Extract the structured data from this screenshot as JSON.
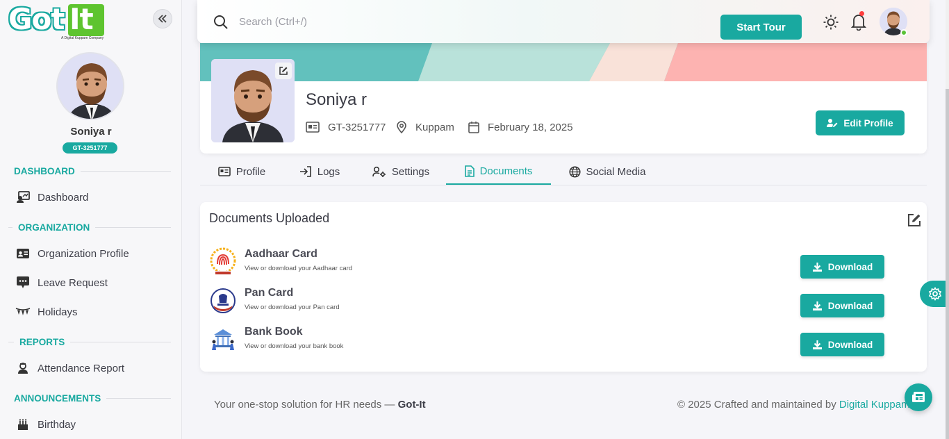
{
  "brand": {
    "logo_got": "Got",
    "logo_it": "It",
    "logo_tagline": "A Digital Kuppam Company"
  },
  "sidebar": {
    "collapse_icon": "double-chevron-left-icon",
    "user_name": "Soniya r",
    "user_id": "GT-3251777",
    "sections": [
      {
        "title": "DASHBOARD",
        "items": [
          {
            "label": "Dashboard",
            "icon": "dashboard-icon"
          }
        ]
      },
      {
        "title": "ORGANIZATION",
        "items": [
          {
            "label": "Organization Profile",
            "icon": "id-card-icon"
          },
          {
            "label": "Leave Request",
            "icon": "leave-request-icon"
          },
          {
            "label": "Holidays",
            "icon": "holidays-icon"
          }
        ]
      },
      {
        "title": "REPORTS",
        "items": [
          {
            "label": "Attendance Report",
            "icon": "attendance-report-icon"
          }
        ]
      },
      {
        "title": "ANNOUNCEMENTS",
        "items": [
          {
            "label": "Birthday",
            "icon": "birthday-cake-icon"
          }
        ]
      }
    ]
  },
  "topbar": {
    "search_placeholder": "Search (Ctrl+/)",
    "start_tour": "Start Tour"
  },
  "profile": {
    "name": "Soniya r",
    "employee_id": "GT-3251777",
    "location": "Kuppam",
    "date": "February 18, 2025",
    "edit_profile": "Edit Profile"
  },
  "tabs": [
    {
      "label": "Profile",
      "icon": "id-card-icon",
      "active": false
    },
    {
      "label": "Logs",
      "icon": "login-icon",
      "active": false
    },
    {
      "label": "Settings",
      "icon": "user-settings-icon",
      "active": false
    },
    {
      "label": "Documents",
      "icon": "document-icon",
      "active": true
    },
    {
      "label": "Social Media",
      "icon": "globe-icon",
      "active": false
    }
  ],
  "documents": {
    "title": "Documents Uploaded",
    "items": [
      {
        "name": "Aadhaar Card",
        "description": "View or download your Aadhaar card",
        "button": "Download",
        "icon": "aadhaar-logo-icon"
      },
      {
        "name": "Pan Card",
        "description": "View or download your Pan card",
        "button": "Download",
        "icon": "pan-card-emblem-icon"
      },
      {
        "name": "Bank Book",
        "description": "View or download your bank book",
        "button": "Download",
        "icon": "bank-icon"
      }
    ]
  },
  "footer": {
    "left_text": "Your one-stop solution for HR needs — ",
    "left_brand": "Got-It",
    "right_text": "© 2025 Crafted and maintained by ",
    "right_brand": "Digital Kuppam"
  },
  "colors": {
    "accent": "#19a9a0",
    "logo_green": "#5ec42f",
    "notification": "#ff3e3e",
    "online": "#5bc236"
  }
}
